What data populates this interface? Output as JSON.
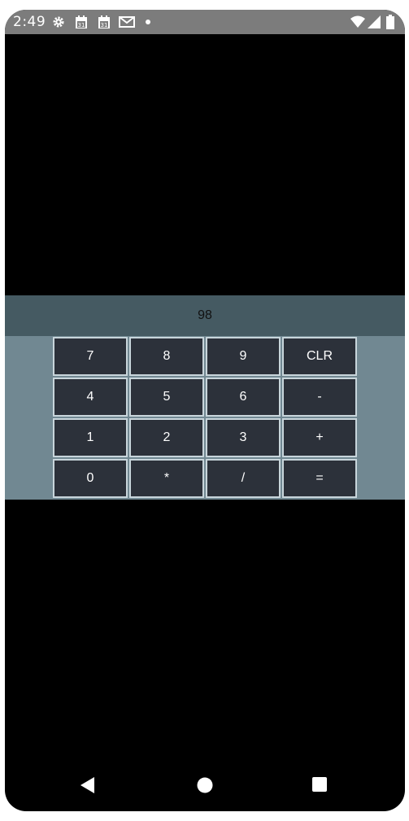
{
  "status_bar": {
    "time": "2:49",
    "icons": [
      "gear-icon",
      "calendar-icon",
      "calendar-icon",
      "gmail-icon",
      "dot-icon",
      "wifi-icon",
      "signal-icon",
      "battery-icon"
    ]
  },
  "calculator": {
    "display_value": "98",
    "keys": [
      {
        "label": "7"
      },
      {
        "label": "8"
      },
      {
        "label": "9"
      },
      {
        "label": "CLR"
      },
      {
        "label": "4"
      },
      {
        "label": "5"
      },
      {
        "label": "6"
      },
      {
        "label": "-"
      },
      {
        "label": "1"
      },
      {
        "label": "2"
      },
      {
        "label": "3"
      },
      {
        "label": "+"
      },
      {
        "label": "0"
      },
      {
        "label": "*"
      },
      {
        "label": "/"
      },
      {
        "label": "="
      }
    ]
  },
  "colors": {
    "display_bg": "#455a62",
    "panel_bg": "#718892",
    "key_bg": "#2c313a",
    "key_border": "#c8d5db"
  },
  "nav_bar": {
    "icons": [
      "back-icon",
      "home-icon",
      "recents-icon"
    ]
  }
}
